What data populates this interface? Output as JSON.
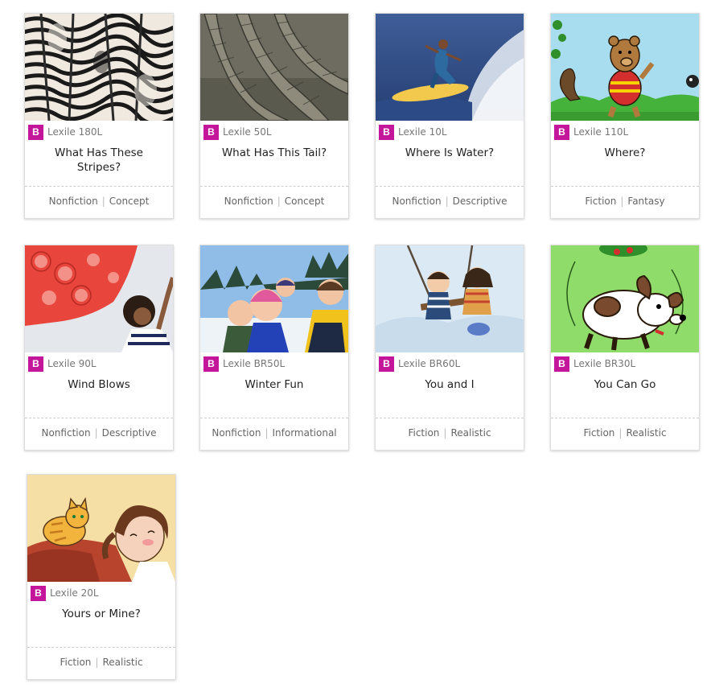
{
  "level_badge": "B",
  "badge_color": "#c4169b",
  "books": [
    {
      "title": "What Has These Stripes?",
      "lexile": "Lexile 180L",
      "genre": "Nonfiction",
      "subgenre": "Concept",
      "cover": "zebras-cover-image"
    },
    {
      "title": "What Has This Tail?",
      "lexile": "Lexile 50L",
      "genre": "Nonfiction",
      "subgenre": "Concept",
      "cover": "alligator-tail-cover-image"
    },
    {
      "title": "Where Is Water?",
      "lexile": "Lexile 10L",
      "genre": "Nonfiction",
      "subgenre": "Descriptive",
      "cover": "surfer-cover-image"
    },
    {
      "title": "Where?",
      "lexile": "Lexile 110L",
      "genre": "Fiction",
      "subgenre": "Fantasy",
      "cover": "cartoon-bear-cover-image"
    },
    {
      "title": "Wind Blows",
      "lexile": "Lexile 90L",
      "genre": "Nonfiction",
      "subgenre": "Descriptive",
      "cover": "girl-with-scarf-cover-image"
    },
    {
      "title": "Winter Fun",
      "lexile": "Lexile BR50L",
      "genre": "Nonfiction",
      "subgenre": "Informational",
      "cover": "kids-in-snow-cover-image"
    },
    {
      "title": "You and I",
      "lexile": "Lexile BR60L",
      "genre": "Fiction",
      "subgenre": "Realistic",
      "cover": "kids-on-swing-cover-image"
    },
    {
      "title": "You Can Go",
      "lexile": "Lexile BR30L",
      "genre": "Fiction",
      "subgenre": "Realistic",
      "cover": "cartoon-dog-cover-image"
    },
    {
      "title": "Yours or Mine?",
      "lexile": "Lexile 20L",
      "genre": "Fiction",
      "subgenre": "Realistic",
      "cover": "girl-and-cat-cover-image"
    }
  ]
}
